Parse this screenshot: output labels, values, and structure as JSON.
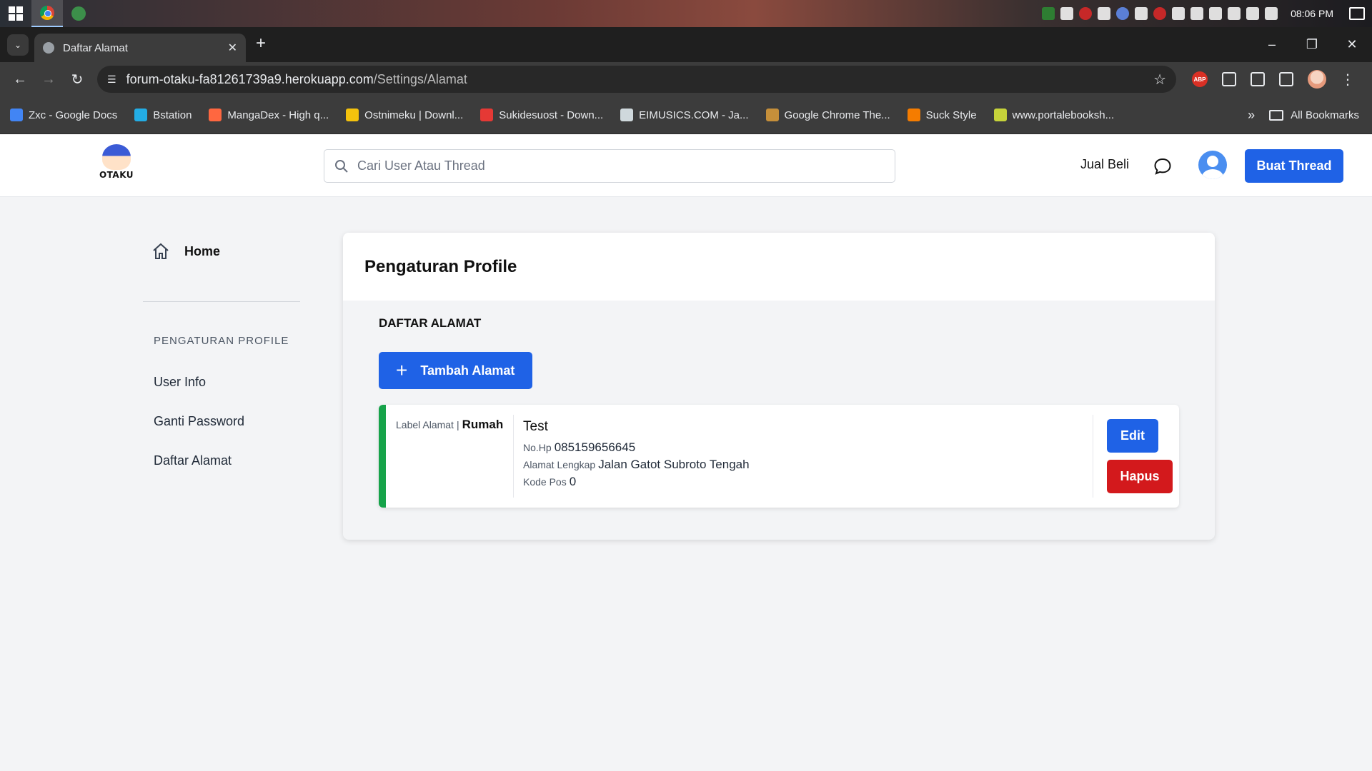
{
  "taskbar": {
    "time": "08:06 PM"
  },
  "browser": {
    "tab_title": "Daftar Alamat",
    "url_host": "forum-otaku-fa81261739a9.herokuapp.com",
    "url_path": "/Settings/Alamat",
    "abp_label": "ABP",
    "bookmarks": [
      {
        "label": "Zxc - Google Docs",
        "color": "#4285f4"
      },
      {
        "label": "Bstation",
        "color": "#23ade5"
      },
      {
        "label": "MangaDex - High q...",
        "color": "#ff6740"
      },
      {
        "label": "Ostnimeku | Downl...",
        "color": "#f4c20d"
      },
      {
        "label": "Sukidesuost - Down...",
        "color": "#e53935"
      },
      {
        "label": "EIMUSICS.COM - Ja...",
        "color": "#cfd8dc"
      },
      {
        "label": "Google Chrome The...",
        "color": "#c58f3a"
      },
      {
        "label": "Suck Style",
        "color": "#f57c00"
      },
      {
        "label": "www.portalebooksh...",
        "color": "#c6d33a"
      }
    ],
    "all_bookmarks": "All Bookmarks"
  },
  "header": {
    "logo_text": "OTAKU",
    "search_placeholder": "Cari User Atau Thread",
    "jual_beli": "Jual Beli",
    "buat_thread": "Buat Thread"
  },
  "sidebar": {
    "home": "Home",
    "section_title": "PENGATURAN PROFILE",
    "links": [
      "User Info",
      "Ganti Password",
      "Daftar Alamat"
    ]
  },
  "main": {
    "title": "Pengaturan Profile",
    "section_title": "DAFTAR ALAMAT",
    "add_button": "Tambah Alamat",
    "address": {
      "label_caption": "Label Alamat",
      "separator": "|",
      "label_value": "Rumah",
      "name": "Test",
      "phone_caption": "No.Hp",
      "phone": "085159656645",
      "full_caption": "Alamat Lengkap",
      "full_address": "Jalan Gatot Subroto Tengah",
      "postal_caption": "Kode Pos",
      "postal_code": "0",
      "accent_color": "#16a34a"
    },
    "edit_button": "Edit",
    "delete_button": "Hapus"
  }
}
